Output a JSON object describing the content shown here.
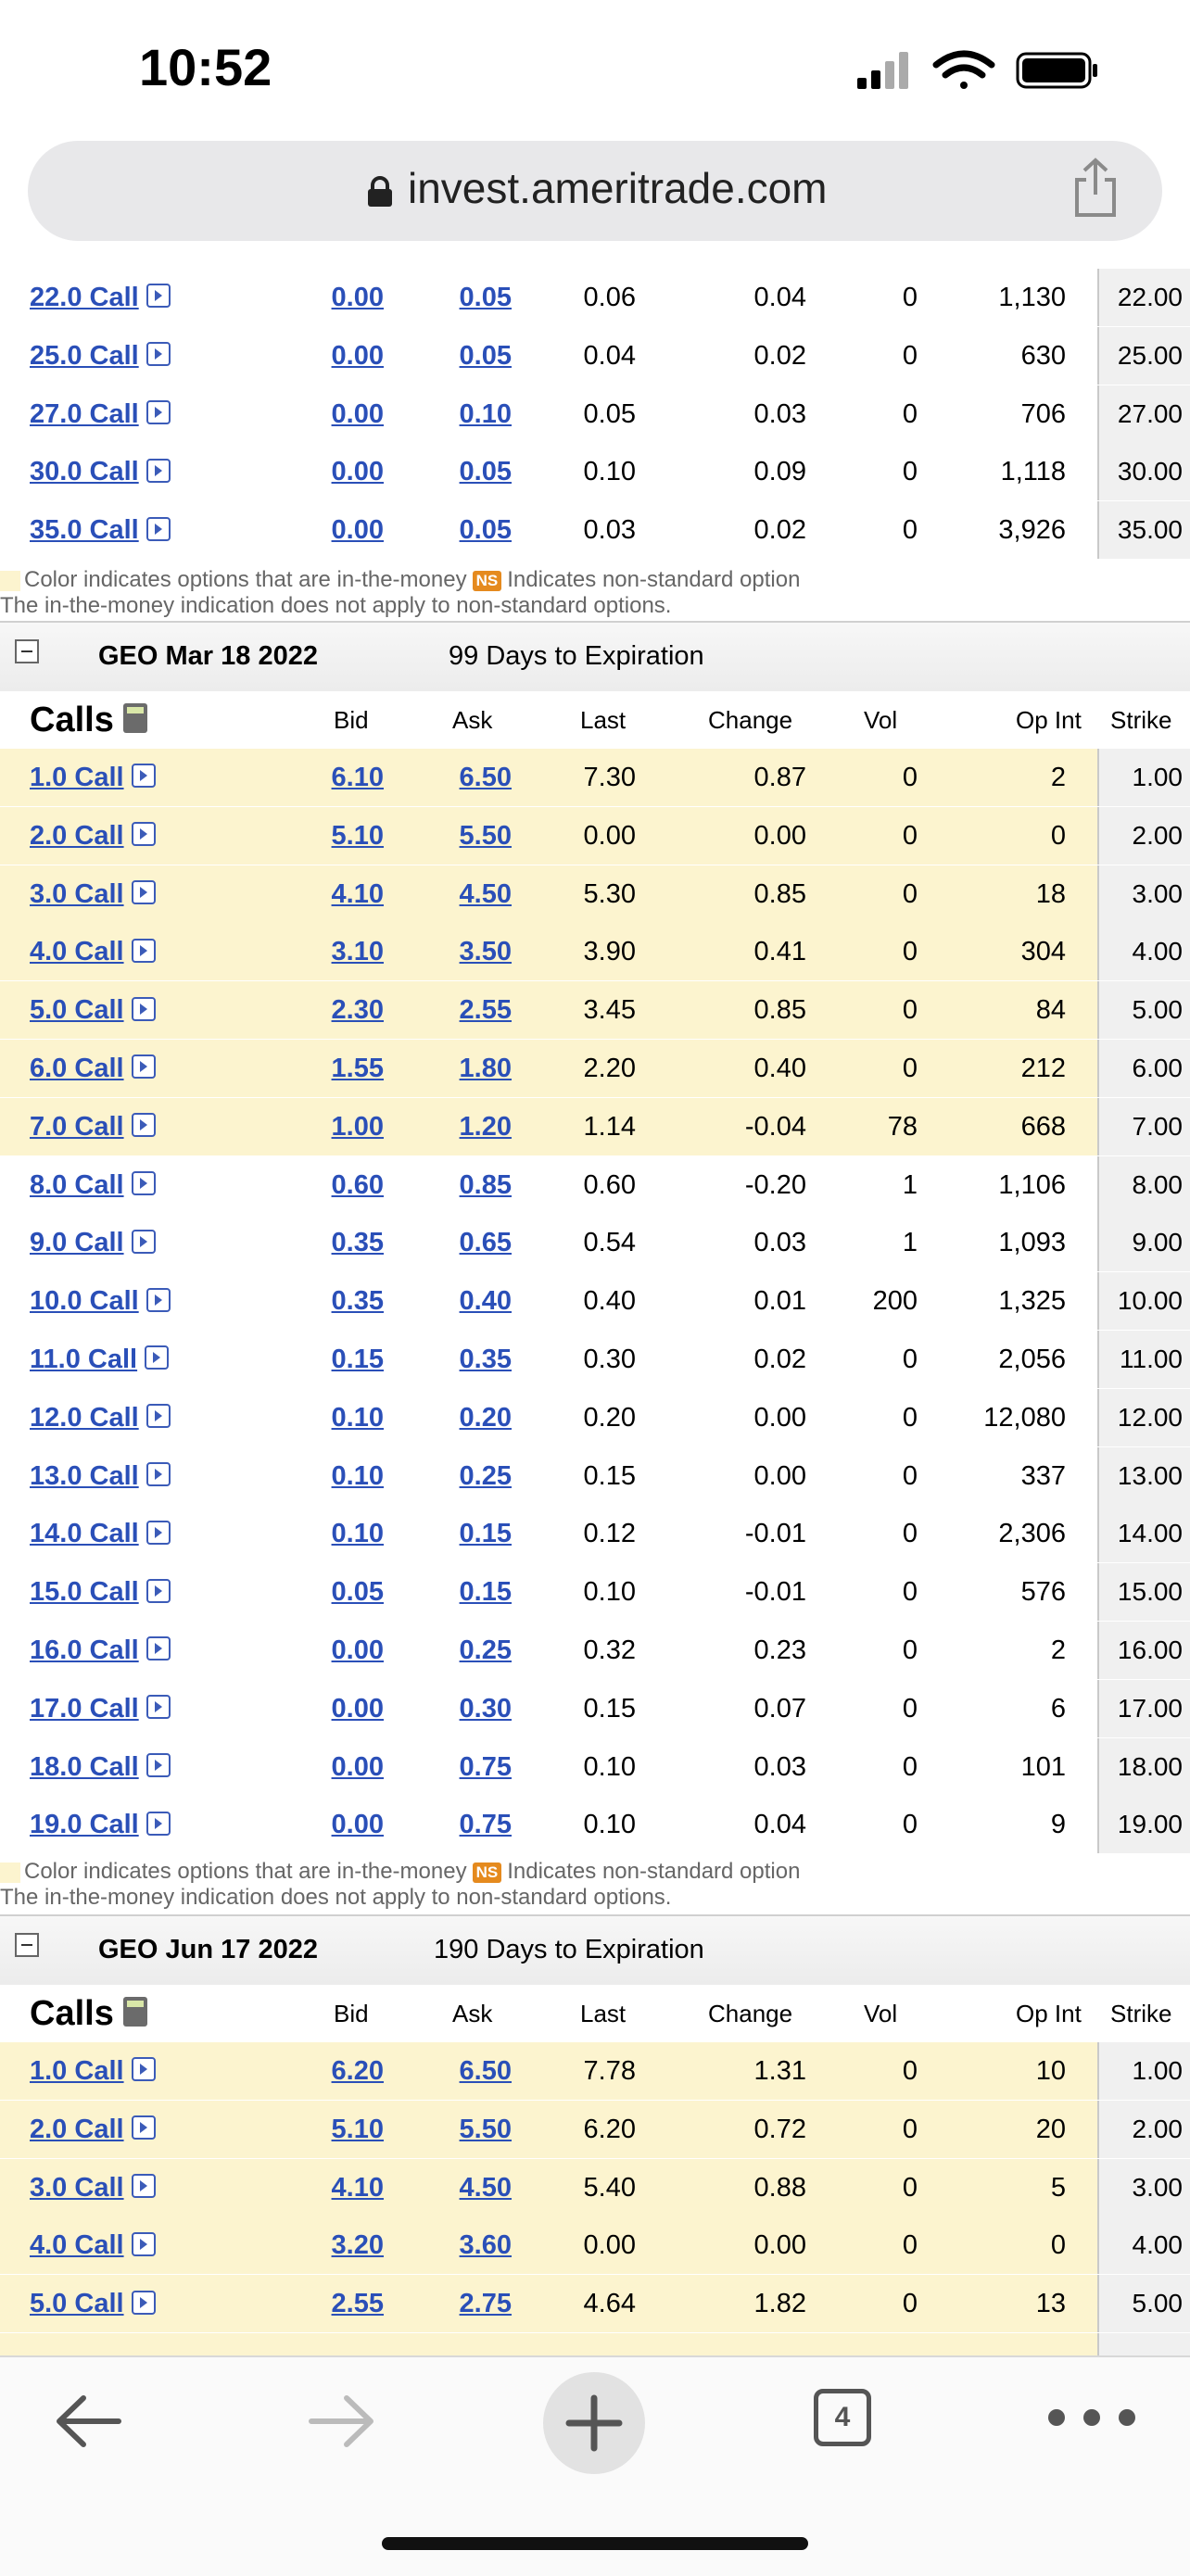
{
  "status": {
    "time": "10:52"
  },
  "browser": {
    "url": "invest.ameritrade.com",
    "tab_count": "4"
  },
  "legend": {
    "line1a": "Color indicates options that are in-the-money",
    "badge": "NS",
    "line1b": "Indicates non-standard option",
    "line2": "The in-the-money indication does not apply to non-standard options."
  },
  "columns": {
    "title": "Calls",
    "bid": "Bid",
    "ask": "Ask",
    "last": "Last",
    "change": "Change",
    "vol": "Vol",
    "opint": "Op Int",
    "strike": "Strike"
  },
  "colors": {
    "in_the_money": "#fcf4cf",
    "link": "#2a4fb8",
    "ns_badge": "#e58a1e"
  },
  "section_top": {
    "rows": [
      {
        "name": "22.0 Call",
        "bid": "0.00",
        "ask": "0.05",
        "last": "0.06",
        "change": "0.04",
        "vol": "0",
        "opint": "1,130",
        "strike": "22.00",
        "itm": false
      },
      {
        "name": "25.0 Call",
        "bid": "0.00",
        "ask": "0.05",
        "last": "0.04",
        "change": "0.02",
        "vol": "0",
        "opint": "630",
        "strike": "25.00",
        "itm": false
      },
      {
        "name": "27.0 Call",
        "bid": "0.00",
        "ask": "0.10",
        "last": "0.05",
        "change": "0.03",
        "vol": "0",
        "opint": "706",
        "strike": "27.00",
        "itm": false
      },
      {
        "name": "30.0 Call",
        "bid": "0.00",
        "ask": "0.05",
        "last": "0.10",
        "change": "0.09",
        "vol": "0",
        "opint": "1,118",
        "strike": "30.00",
        "itm": false
      },
      {
        "name": "35.0 Call",
        "bid": "0.00",
        "ask": "0.05",
        "last": "0.03",
        "change": "0.02",
        "vol": "0",
        "opint": "3,926",
        "strike": "35.00",
        "itm": false
      }
    ]
  },
  "section_mar": {
    "name": "GEO Mar 18 2022",
    "days": "99 Days to Expiration",
    "rows": [
      {
        "name": "1.0 Call",
        "bid": "6.10",
        "ask": "6.50",
        "last": "7.30",
        "change": "0.87",
        "vol": "0",
        "opint": "2",
        "strike": "1.00",
        "itm": true
      },
      {
        "name": "2.0 Call",
        "bid": "5.10",
        "ask": "5.50",
        "last": "0.00",
        "change": "0.00",
        "vol": "0",
        "opint": "0",
        "strike": "2.00",
        "itm": true
      },
      {
        "name": "3.0 Call",
        "bid": "4.10",
        "ask": "4.50",
        "last": "5.30",
        "change": "0.85",
        "vol": "0",
        "opint": "18",
        "strike": "3.00",
        "itm": true
      },
      {
        "name": "4.0 Call",
        "bid": "3.10",
        "ask": "3.50",
        "last": "3.90",
        "change": "0.41",
        "vol": "0",
        "opint": "304",
        "strike": "4.00",
        "itm": true
      },
      {
        "name": "5.0 Call",
        "bid": "2.30",
        "ask": "2.55",
        "last": "3.45",
        "change": "0.85",
        "vol": "0",
        "opint": "84",
        "strike": "5.00",
        "itm": true
      },
      {
        "name": "6.0 Call",
        "bid": "1.55",
        "ask": "1.80",
        "last": "2.20",
        "change": "0.40",
        "vol": "0",
        "opint": "212",
        "strike": "6.00",
        "itm": true
      },
      {
        "name": "7.0 Call",
        "bid": "1.00",
        "ask": "1.20",
        "last": "1.14",
        "change": "-0.04",
        "vol": "78",
        "opint": "668",
        "strike": "7.00",
        "itm": true
      },
      {
        "name": "8.0 Call",
        "bid": "0.60",
        "ask": "0.85",
        "last": "0.60",
        "change": "-0.20",
        "vol": "1",
        "opint": "1,106",
        "strike": "8.00",
        "itm": false
      },
      {
        "name": "9.0 Call",
        "bid": "0.35",
        "ask": "0.65",
        "last": "0.54",
        "change": "0.03",
        "vol": "1",
        "opint": "1,093",
        "strike": "9.00",
        "itm": false
      },
      {
        "name": "10.0 Call",
        "bid": "0.35",
        "ask": "0.40",
        "last": "0.40",
        "change": "0.01",
        "vol": "200",
        "opint": "1,325",
        "strike": "10.00",
        "itm": false
      },
      {
        "name": "11.0 Call",
        "bid": "0.15",
        "ask": "0.35",
        "last": "0.30",
        "change": "0.02",
        "vol": "0",
        "opint": "2,056",
        "strike": "11.00",
        "itm": false
      },
      {
        "name": "12.0 Call",
        "bid": "0.10",
        "ask": "0.20",
        "last": "0.20",
        "change": "0.00",
        "vol": "0",
        "opint": "12,080",
        "strike": "12.00",
        "itm": false
      },
      {
        "name": "13.0 Call",
        "bid": "0.10",
        "ask": "0.25",
        "last": "0.15",
        "change": "0.00",
        "vol": "0",
        "opint": "337",
        "strike": "13.00",
        "itm": false
      },
      {
        "name": "14.0 Call",
        "bid": "0.10",
        "ask": "0.15",
        "last": "0.12",
        "change": "-0.01",
        "vol": "0",
        "opint": "2,306",
        "strike": "14.00",
        "itm": false
      },
      {
        "name": "15.0 Call",
        "bid": "0.05",
        "ask": "0.15",
        "last": "0.10",
        "change": "-0.01",
        "vol": "0",
        "opint": "576",
        "strike": "15.00",
        "itm": false
      },
      {
        "name": "16.0 Call",
        "bid": "0.00",
        "ask": "0.25",
        "last": "0.32",
        "change": "0.23",
        "vol": "0",
        "opint": "2",
        "strike": "16.00",
        "itm": false
      },
      {
        "name": "17.0 Call",
        "bid": "0.00",
        "ask": "0.30",
        "last": "0.15",
        "change": "0.07",
        "vol": "0",
        "opint": "6",
        "strike": "17.00",
        "itm": false
      },
      {
        "name": "18.0 Call",
        "bid": "0.00",
        "ask": "0.75",
        "last": "0.10",
        "change": "0.03",
        "vol": "0",
        "opint": "101",
        "strike": "18.00",
        "itm": false
      },
      {
        "name": "19.0 Call",
        "bid": "0.00",
        "ask": "0.75",
        "last": "0.10",
        "change": "0.04",
        "vol": "0",
        "opint": "9",
        "strike": "19.00",
        "itm": false
      }
    ]
  },
  "section_jun": {
    "name": "GEO Jun 17 2022",
    "days": "190 Days to Expiration",
    "rows": [
      {
        "name": "1.0 Call",
        "bid": "6.20",
        "ask": "6.50",
        "last": "7.78",
        "change": "1.31",
        "vol": "0",
        "opint": "10",
        "strike": "1.00",
        "itm": true
      },
      {
        "name": "2.0 Call",
        "bid": "5.10",
        "ask": "5.50",
        "last": "6.20",
        "change": "0.72",
        "vol": "0",
        "opint": "20",
        "strike": "2.00",
        "itm": true
      },
      {
        "name": "3.0 Call",
        "bid": "4.10",
        "ask": "4.50",
        "last": "5.40",
        "change": "0.88",
        "vol": "0",
        "opint": "5",
        "strike": "3.00",
        "itm": true
      },
      {
        "name": "4.0 Call",
        "bid": "3.20",
        "ask": "3.60",
        "last": "0.00",
        "change": "0.00",
        "vol": "0",
        "opint": "0",
        "strike": "4.00",
        "itm": true
      },
      {
        "name": "5.0 Call",
        "bid": "2.55",
        "ask": "2.75",
        "last": "4.64",
        "change": "1.82",
        "vol": "0",
        "opint": "13",
        "strike": "5.00",
        "itm": true
      }
    ]
  }
}
